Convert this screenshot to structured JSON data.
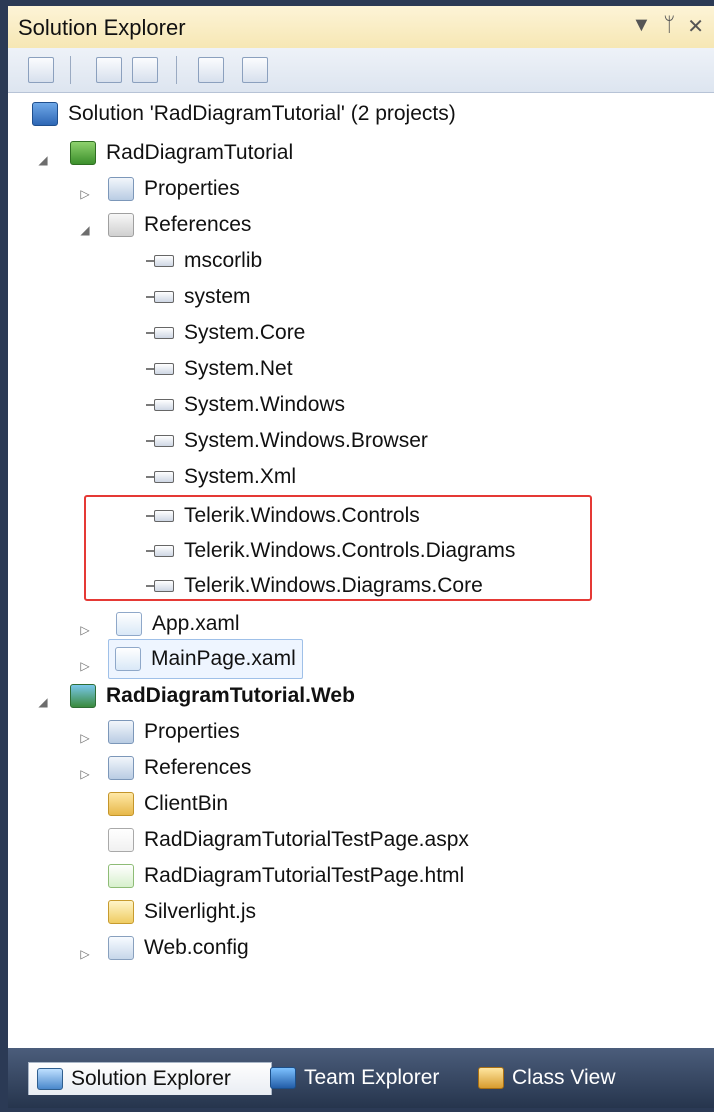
{
  "panel": {
    "title": "Solution Explorer",
    "controls": {
      "dropdown": "▼",
      "pin": "ᛘ",
      "close": "✕"
    }
  },
  "toolbar": {
    "buttons": [
      {
        "name": "properties-icon",
        "icon": "properties-icon"
      },
      {
        "name": "show-all-files-icon",
        "icon": "show-all-files-icon"
      },
      {
        "name": "refresh-icon",
        "icon": "refresh-icon"
      },
      {
        "name": "view-code-icon",
        "icon": "view-code-icon"
      },
      {
        "name": "view-designer-icon",
        "icon": "view-designer-icon"
      }
    ]
  },
  "tree": {
    "solution": "Solution 'RadDiagramTutorial' (2 projects)",
    "project1": "RadDiagramTutorial",
    "project1_items": {
      "properties": "Properties",
      "references": "References",
      "refs": [
        "mscorlib",
        "system",
        "System.Core",
        "System.Net",
        "System.Windows",
        "System.Windows.Browser",
        "System.Xml",
        "Telerik.Windows.Controls",
        "Telerik.Windows.Controls.Diagrams",
        "Telerik.Windows.Diagrams.Core"
      ],
      "app": "App.xaml",
      "mainpage": "MainPage.xaml"
    },
    "project2": "RadDiagramTutorial.Web",
    "project2_items": {
      "properties": "Properties",
      "references": "References",
      "clientbin": "ClientBin",
      "aspx": "RadDiagramTutorialTestPage.aspx",
      "html": "RadDiagramTutorialTestPage.html",
      "js": "Silverlight.js",
      "config": "Web.config"
    }
  },
  "tabs": {
    "solution": "Solution Explorer",
    "team": "Team Explorer",
    "class": "Class View"
  }
}
